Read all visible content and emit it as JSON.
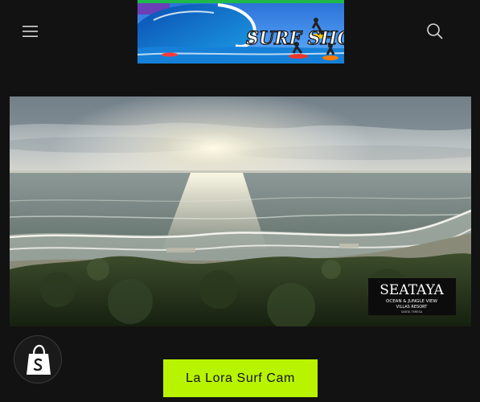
{
  "header": {
    "menu_icon": "hamburger-menu-icon",
    "search_icon": "search-icon",
    "logo": {
      "text": "SURF SHOW !!"
    }
  },
  "hero": {
    "overlay_logo": {
      "title": "SEATAYA",
      "subtitle": "OCEAN & JUNGLE VIEW",
      "line3": "VILLAS RESORT",
      "line4": "SANTA TERESA"
    }
  },
  "shop_badge": {
    "icon": "shopify-bag-icon"
  },
  "cta": {
    "label": "La Lora Surf Cam",
    "color": "#b8f400"
  }
}
